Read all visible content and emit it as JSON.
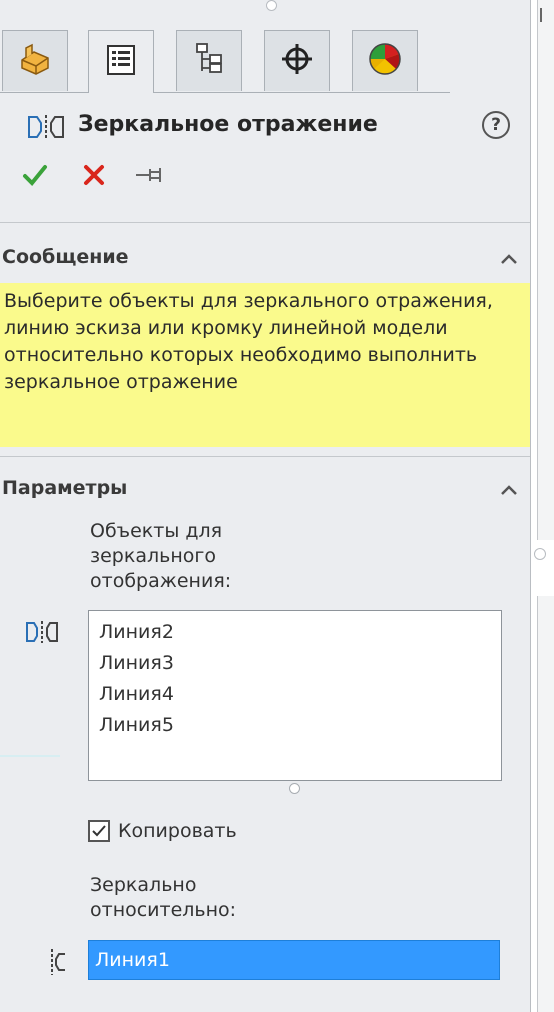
{
  "tabs": [
    {
      "id": "feature-manager",
      "icon": "part-icon"
    },
    {
      "id": "property-manager",
      "icon": "property-list-icon",
      "active": true
    },
    {
      "id": "configuration-manager",
      "icon": "configuration-icon"
    },
    {
      "id": "dimxpert-manager",
      "icon": "crosshair-icon"
    },
    {
      "id": "display-manager",
      "icon": "appearance-pie-icon"
    }
  ],
  "header": {
    "title": "Зеркальное отражение",
    "help_label": "?"
  },
  "actions": {
    "ok_icon": "checkmark-icon",
    "cancel_icon": "close-icon",
    "pin_icon": "pushpin-icon"
  },
  "message_section": {
    "title": "Сообщение",
    "text": "Выберите объекты для зеркального отражения, линию эскиза или кромку линейной модели относительно которых необходимо выполнить зеркальное отражение"
  },
  "params_section": {
    "title": "Параметры",
    "objects_label": "Объекты для зеркального отображения:",
    "objects": [
      "Линия2",
      "Линия3",
      "Линия4",
      "Линия5"
    ],
    "copy_label": "Копировать",
    "copy_checked": true,
    "mirror_about_label": "Зеркально относительно:",
    "mirror_about_value": "Линия1"
  },
  "colors": {
    "message_bg": "#fafa8c",
    "selection_bg": "#3399ff",
    "ok_green": "#3aa23a",
    "cancel_red": "#d9261c"
  }
}
